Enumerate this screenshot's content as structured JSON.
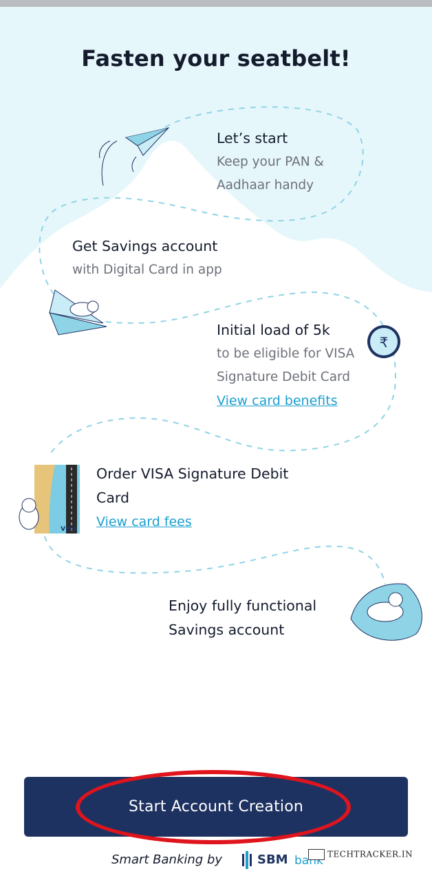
{
  "page": {
    "title": "Fasten your seatbelt!"
  },
  "steps": [
    {
      "heading": "Let’s start",
      "sub": "Keep your PAN &",
      "sub2": "Aadhaar handy"
    },
    {
      "heading": "Get Savings account",
      "sub": "with Digital Card in app"
    },
    {
      "heading": "Initial load of 5k",
      "sub": "to be eligible for VISA",
      "sub2": "Signature Debit Card",
      "link": "View card benefits"
    },
    {
      "heading": "Order VISA Signature Debit",
      "heading2": "Card",
      "link": "View card fees"
    },
    {
      "heading": "Enjoy fully functional",
      "heading2": "Savings account"
    }
  ],
  "cta": {
    "label": "Start Account Creation"
  },
  "footer": {
    "tagline": "Smart Banking by",
    "brand": "SBM",
    "brand_suffix": "bank"
  },
  "watermark": "TECHTRACKER.IN",
  "icons": {
    "plane_top": "paper-plane-icon",
    "plane_dog": "dog-paper-plane-icon",
    "rupee": "rupee-coin-icon",
    "card": "visa-card-icon",
    "dog_beanbag": "dog-beanbag-icon"
  },
  "colors": {
    "accent": "#1a9fd0",
    "cta_bg": "#1e3261",
    "sky": "#e6f7fb",
    "dash": "#8fd3e6",
    "highlight_ring": "#e0141c"
  }
}
